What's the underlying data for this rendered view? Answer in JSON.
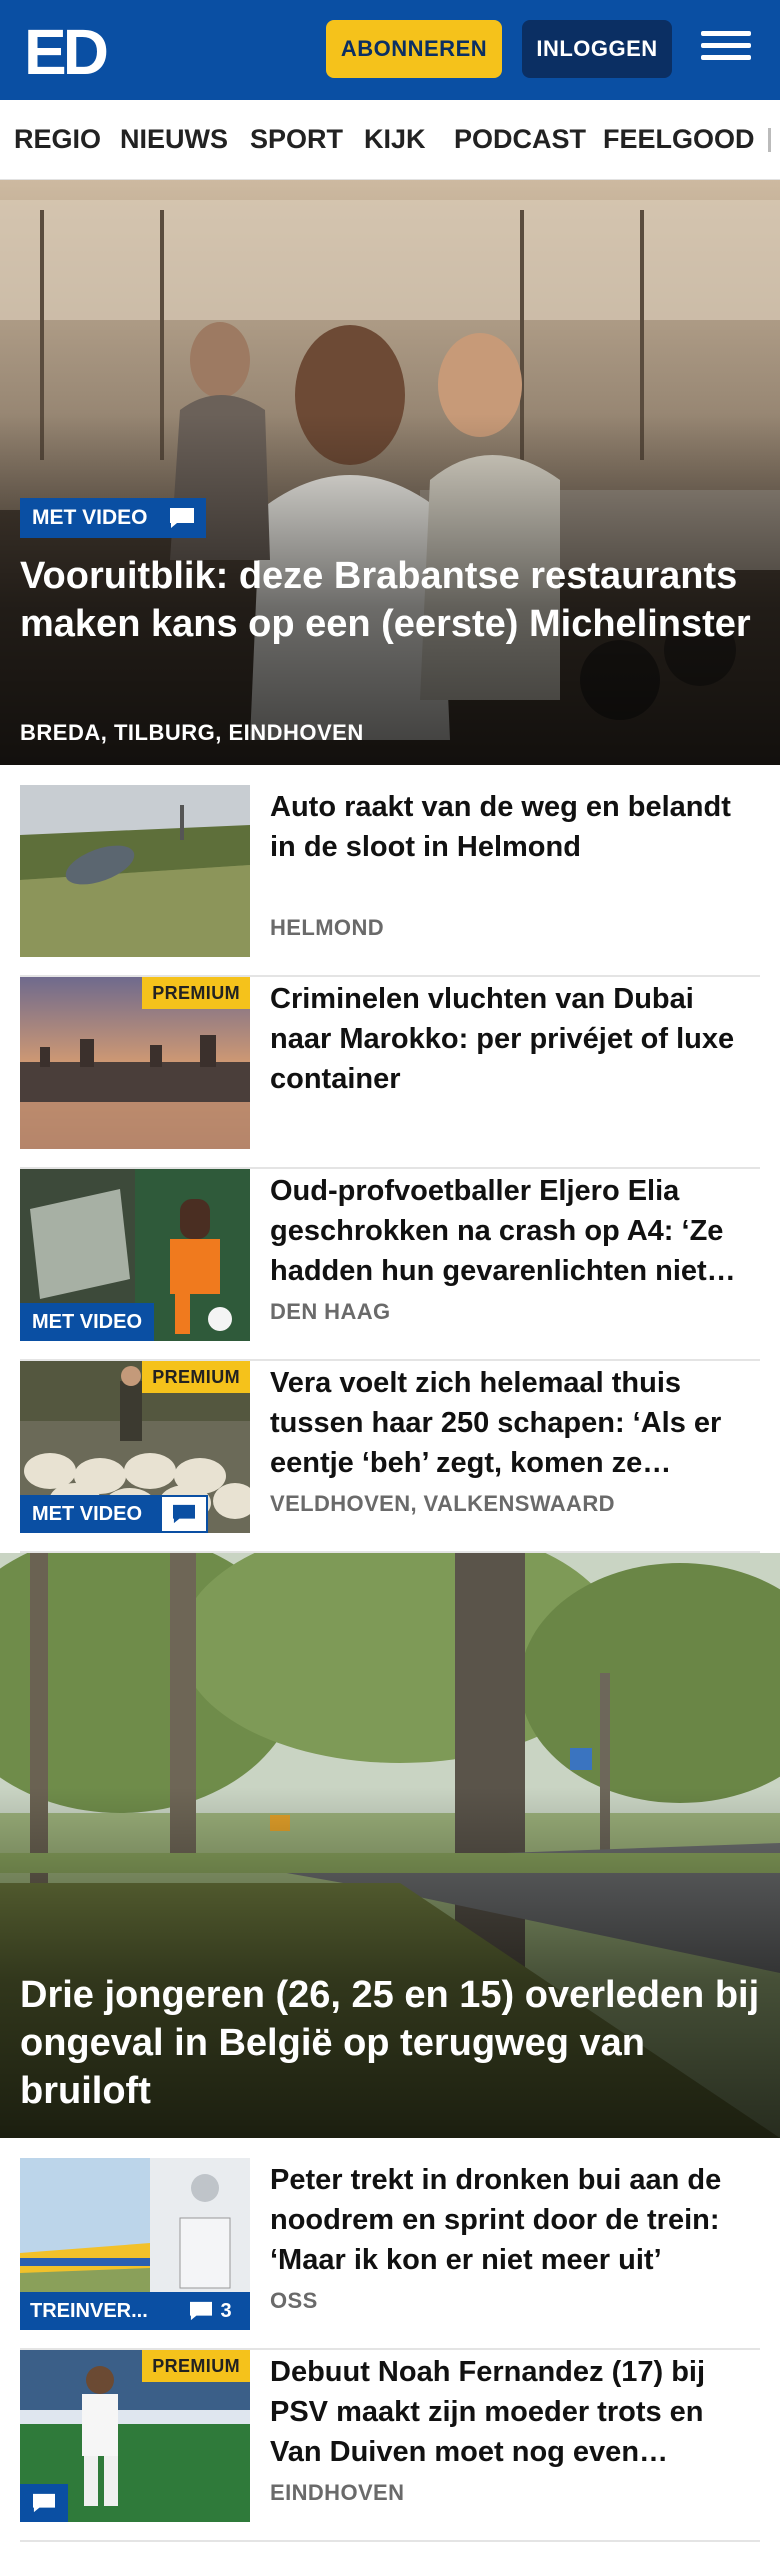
{
  "header": {
    "logo_text": "ED",
    "subscribe_label": "ABONNEREN",
    "login_label": "INLOGGEN"
  },
  "nav": {
    "items": [
      "REGIO",
      "NIEUWS",
      "SPORT",
      "KIJK",
      "PODCAST",
      "FEELGOOD"
    ]
  },
  "hero1": {
    "badge": "MET VIDEO",
    "title": "Vooruitblik: deze Brabantse restau­rants maken kans op een (eerste) Michelinster",
    "location": "BREDA, TILBURG, EINDHOVEN"
  },
  "articles1": [
    {
      "title": "Auto raakt van de weg en belandt in de sloot in Helmond",
      "location": "HELMOND"
    },
    {
      "premium": "PREMIUM",
      "title": "Criminelen vluchten van Dubai naar Marokko: per privéjet of luxe container"
    },
    {
      "video": "MET VIDEO",
      "title": "Oud-profvoetballer Eljero Elia geschrokken na crash op A4: ‘Ze hadden hun gevarenlichten niet aan’",
      "location": "DEN HAAG"
    },
    {
      "premium": "PREMIUM",
      "video": "MET VIDEO",
      "title": "Vera voelt zich helemaal thuis tussen haar 250 schapen: ‘Als er eentje ‘beh’ zegt, komen ze allemaal’",
      "location": "VELDHOVEN, VALKENSWAARD"
    }
  ],
  "hero2": {
    "title": "Drie jongeren (26, 25 en 15) overleden bij ongeval in België op terugweg van bruiloft"
  },
  "articles2": [
    {
      "tag": "TREINVER...",
      "comments": "3",
      "title": "Peter trekt in dronken bui aan de noodrem en sprint door de trein: ‘Maar ik kon er niet meer uit’",
      "location": "OSS"
    },
    {
      "premium": "PREMIUM",
      "title": "Debuut Noah Fernandez (17) bij PSV maakt zijn moeder trots en Van Duiven moet nog even wachten",
      "location": "EINDHOVEN"
    }
  ],
  "colors": {
    "brand_blue": "#0a4fa3",
    "premium_yellow": "#f5c21b",
    "dark_navy": "#0b2f63"
  }
}
